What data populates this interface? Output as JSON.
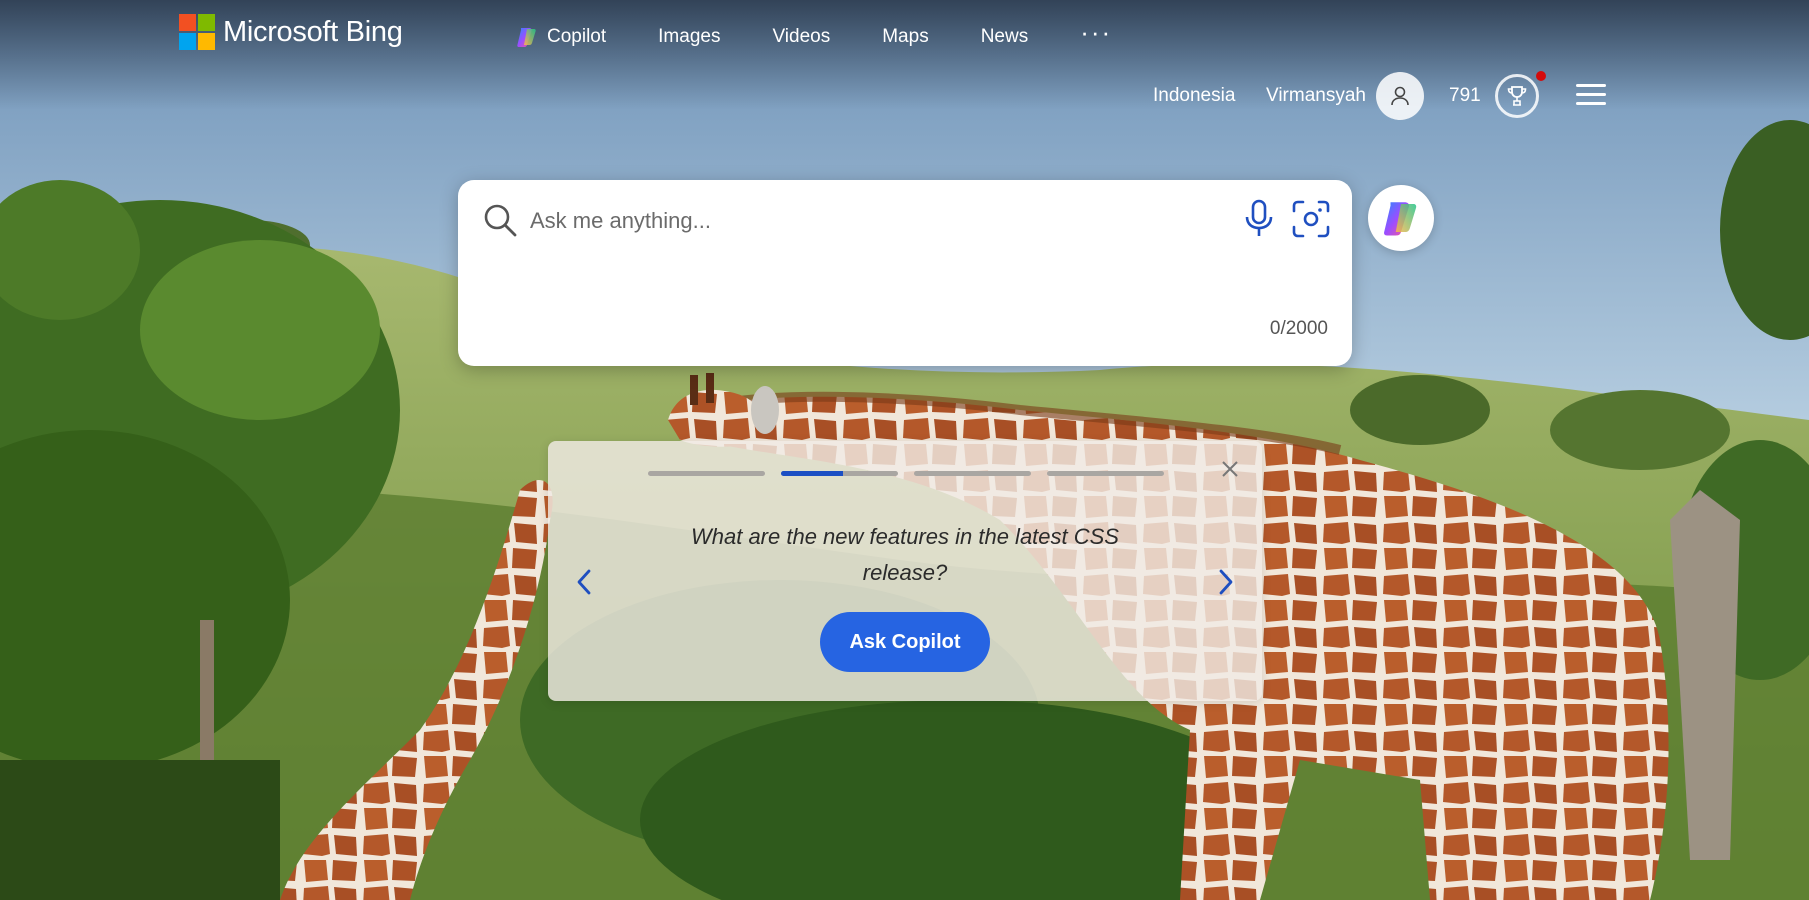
{
  "header": {
    "brand": "Microsoft Bing",
    "nav": [
      {
        "label": "Copilot",
        "icon": "copilot-icon"
      },
      {
        "label": "Images"
      },
      {
        "label": "Videos"
      },
      {
        "label": "Maps"
      },
      {
        "label": "News"
      }
    ],
    "more_label": "···"
  },
  "user": {
    "region": "Indonesia",
    "name": "Virmansyah",
    "points": "791"
  },
  "search": {
    "placeholder": "Ask me anything...",
    "char_count": "0/2000"
  },
  "suggestion": {
    "prompt": "What are the new features in the latest CSS release?",
    "button_label": "Ask Copilot",
    "steps": [
      0,
      0.53,
      0,
      0
    ]
  },
  "colors": {
    "accent": "#2664e2",
    "progress_active": "#1b4fc4",
    "notification": "#d40b0b"
  }
}
